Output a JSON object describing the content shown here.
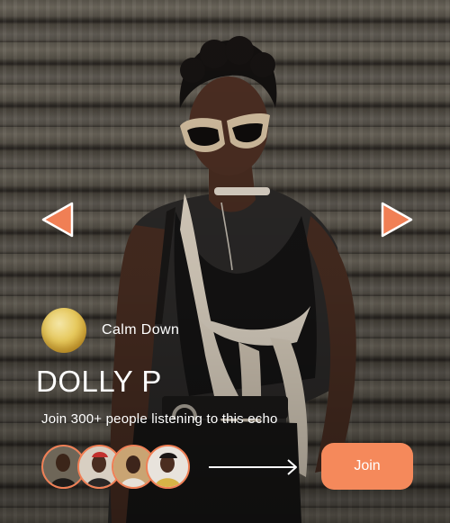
{
  "track": {
    "title": "Calm Down"
  },
  "artist": {
    "name": "DOLLY P"
  },
  "listeners": {
    "text": "Join 300+ people listening to this echo"
  },
  "actions": {
    "join_label": "Join"
  },
  "icons": {
    "prev": "prev-arrow-icon",
    "next": "next-arrow-icon",
    "swipe": "swipe-arrow-icon"
  },
  "colors": {
    "accent": "#f5895b",
    "arrow_fill": "#f07f55",
    "text": "#ffffff"
  }
}
